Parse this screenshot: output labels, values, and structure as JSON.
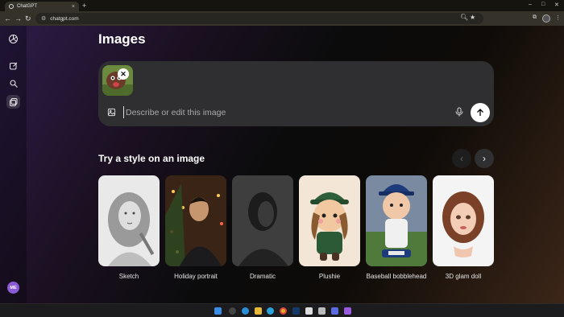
{
  "browser": {
    "tab_title": "ChatGPT",
    "tab_close": "×",
    "new_tab": "+",
    "url": "chatgpt.com",
    "window_controls": {
      "minimize": "–",
      "maximize": "□",
      "close": "✕"
    }
  },
  "sidebar": {
    "avatar_initials": "ME"
  },
  "page": {
    "title": "Images"
  },
  "composer": {
    "placeholder": "Describe or edit this image"
  },
  "styles_section": {
    "title": "Try a style on an image",
    "cards": [
      {
        "label": "Sketch"
      },
      {
        "label": "Holiday portrait"
      },
      {
        "label": "Dramatic"
      },
      {
        "label": "Plushie"
      },
      {
        "label": "Baseball bobblehead"
      },
      {
        "label": "3D glam doll"
      }
    ]
  },
  "taskbar": {
    "clock_time": "",
    "clock_date": ""
  },
  "colors": {
    "accent_avatar": "#8b5bd6",
    "composer_bg": "#2f2f31",
    "send_button": "#ffffff"
  }
}
